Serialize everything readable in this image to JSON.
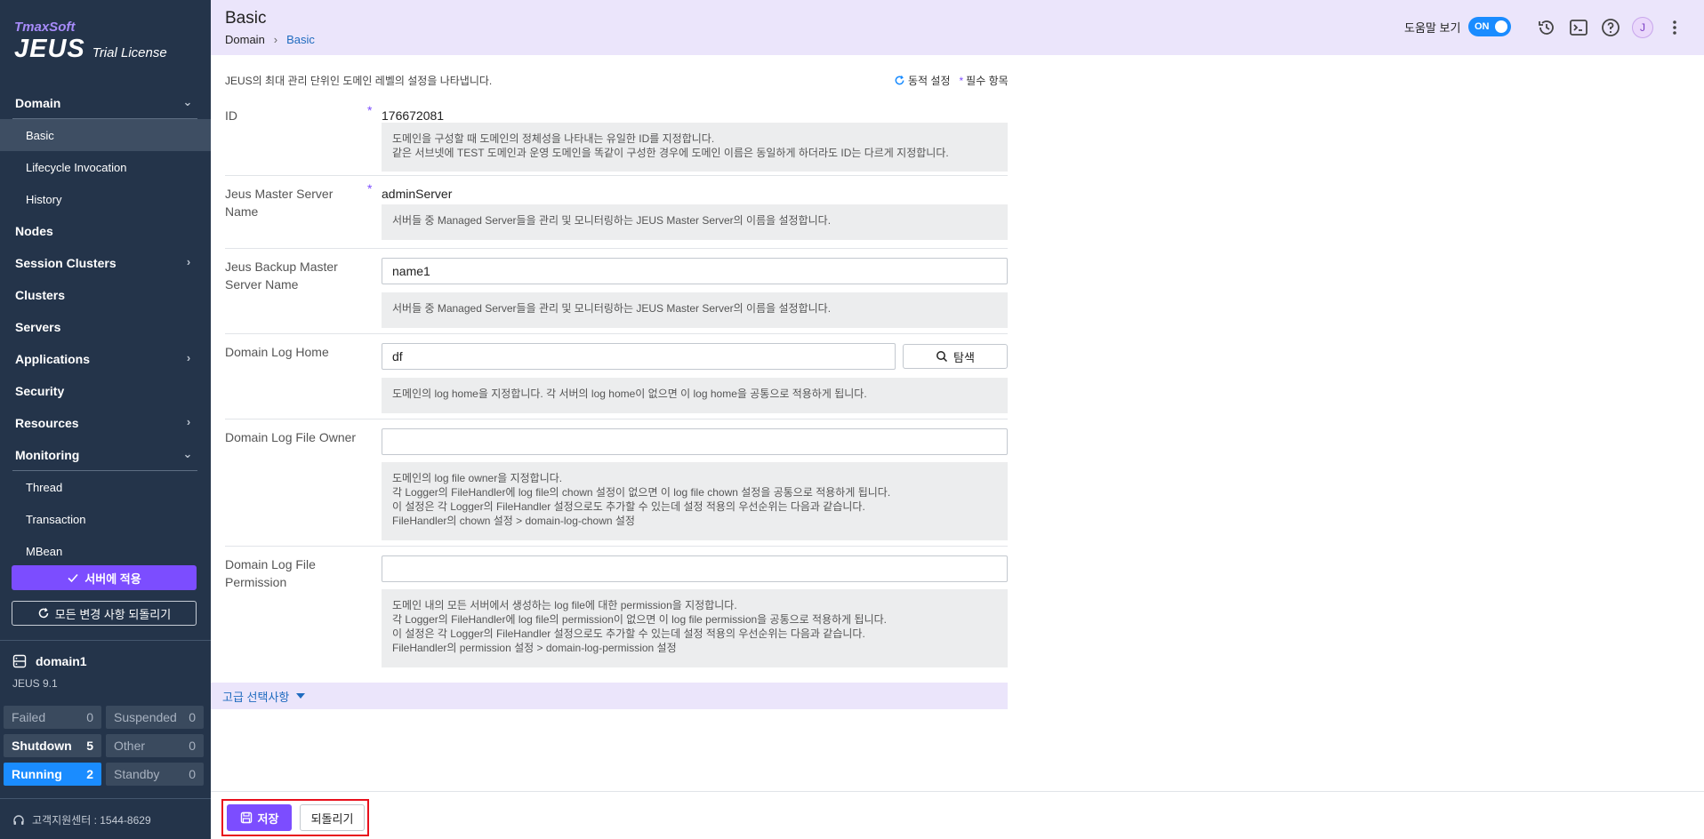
{
  "brand": {
    "company": "TmaxSoft",
    "product": "JEUS",
    "license": "Trial License"
  },
  "sidebar": {
    "nav": [
      {
        "label": "Domain",
        "type": "section",
        "chevron": "down"
      },
      {
        "label": "Basic",
        "type": "sub",
        "active": true
      },
      {
        "label": "Lifecycle Invocation",
        "type": "sub"
      },
      {
        "label": "History",
        "type": "sub"
      },
      {
        "label": "Nodes",
        "type": "item"
      },
      {
        "label": "Session Clusters",
        "type": "item",
        "chevron": "right"
      },
      {
        "label": "Clusters",
        "type": "item"
      },
      {
        "label": "Servers",
        "type": "item"
      },
      {
        "label": "Applications",
        "type": "item",
        "chevron": "right"
      },
      {
        "label": "Security",
        "type": "item"
      },
      {
        "label": "Resources",
        "type": "item",
        "chevron": "right"
      },
      {
        "label": "Monitoring",
        "type": "section",
        "chevron": "down"
      },
      {
        "label": "Thread",
        "type": "sub"
      },
      {
        "label": "Transaction",
        "type": "sub"
      },
      {
        "label": "MBean",
        "type": "sub"
      }
    ],
    "apply_label": "서버에 적용",
    "revert_all_label": "모든 변경 사항 되돌리기",
    "domain": {
      "name": "domain1",
      "version": "JEUS 9.1"
    },
    "stats": [
      {
        "label": "Failed",
        "count": "0"
      },
      {
        "label": "Suspended",
        "count": "0"
      },
      {
        "label": "Shutdown",
        "count": "5"
      },
      {
        "label": "Other",
        "count": "0"
      },
      {
        "label": "Running",
        "count": "2"
      },
      {
        "label": "Standby",
        "count": "0"
      }
    ],
    "support": "고객지원센터 : 1544-8629"
  },
  "header": {
    "title": "Basic",
    "breadcrumb": [
      "Domain",
      "Basic"
    ],
    "help_label": "도움말 보기",
    "toggle_label": "ON",
    "avatar": "J"
  },
  "main": {
    "description": "JEUS의 최대 관리 단위인 도메인 레벨의 설정을 나타냅니다.",
    "legend_dynamic": "동적 설정",
    "legend_required": "필수 항목",
    "fields": {
      "id": {
        "label": "ID",
        "value": "176672081",
        "help": [
          "도메인을 구성할 때 도메인의 정체성을 나타내는 유일한 ID를 지정합니다.",
          "같은 서브넷에 TEST 도메인과 운영 도메인을 똑같이 구성한 경우에 도메인 이름은 동일하게 하더라도 ID는 다르게 지정합니다."
        ]
      },
      "master": {
        "label": "Jeus Master Server Name",
        "value": "adminServer",
        "help": [
          "서버들 중 Managed Server들을 관리 및 모니터링하는 JEUS Master Server의 이름을 설정합니다."
        ]
      },
      "backup": {
        "label": "Jeus Backup Master Server Name",
        "value": "name1",
        "help": [
          "서버들 중 Managed Server들을 관리 및 모니터링하는 JEUS Master Server의 이름을 설정합니다."
        ]
      },
      "loghome": {
        "label": "Domain Log Home",
        "value": "df",
        "search_label": "탐색",
        "help": [
          "도메인의 log home을 지정합니다. 각 서버의 log home이 없으면 이 log home을 공통으로 적용하게 됩니다."
        ]
      },
      "owner": {
        "label": "Domain Log File Owner",
        "value": "",
        "help": [
          "도메인의 log file owner을 지정합니다.",
          "각 Logger의 FileHandler에 log file의 chown 설정이 없으면 이 log file chown 설정을 공통으로 적용하게 됩니다.",
          "이 설정은 각 Logger의 FileHandler 설정으로도 추가할 수 있는데 설정 적용의 우선순위는 다음과 같습니다.",
          "FileHandler의 chown 설정 > domain-log-chown 설정"
        ]
      },
      "permission": {
        "label": "Domain Log File Permission",
        "value": "",
        "help": [
          "도메인 내의 모든 서버에서 생성하는 log file에 대한 permission을 지정합니다.",
          "각 Logger의 FileHandler에 log file의 permission이 없으면 이 log file permission을 공통으로 적용하게 됩니다.",
          "이 설정은 각 Logger의 FileHandler 설정으로도 추가할 수 있는데 설정 적용의 우선순위는 다음과 같습니다.",
          "FileHandler의 permission 설정 > domain-log-permission 설정"
        ]
      }
    },
    "advanced_label": "고급 선택사항"
  },
  "footer": {
    "save_label": "저장",
    "revert_label": "되돌리기"
  },
  "colors": {
    "accent": "#7c4dff",
    "sidebar": "#24344a",
    "running": "#1a8cff",
    "highlight": "#e8101c"
  }
}
